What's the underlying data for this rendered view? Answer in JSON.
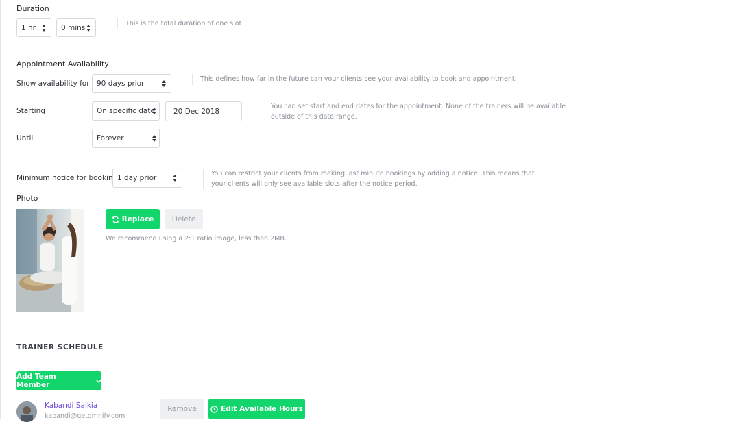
{
  "duration": {
    "title": "Duration",
    "hours": "1 hr",
    "minutes": "0 mins",
    "hint": "This is the total duration of one slot"
  },
  "availability": {
    "title": "Appointment Availability",
    "show_label": "Show availability for",
    "show_value": "90 days prior",
    "show_hint": "This defines how far in the future can your clients see your availability to book and appointment.",
    "starting_label": "Starting",
    "starting_value": "On specific date",
    "start_date": "20 Dec 2018",
    "starting_hint_line1": "You can set start and end dates for the appointment. None of the trainers will be available",
    "starting_hint_line2": "outside of this date range.",
    "until_label": "Until",
    "until_value": "Forever",
    "notice_label": "Minimum notice for booking",
    "notice_value": "1 day prior",
    "notice_hint_line1": "You can restrict your clients from making last minute bookings by adding a notice. This means that",
    "notice_hint_line2": "your clients will only see available slots after the notice period."
  },
  "photo": {
    "title": "Photo",
    "replace_label": "Replace",
    "delete_label": "Delete",
    "recommendation": "We recommend using a 2:1 ratio image, less than 2MB."
  },
  "trainer_schedule": {
    "title": "TRAINER SCHEDULE",
    "add_member_label": "Add Team Member",
    "trainer_name": "Kabandi Saikia",
    "trainer_email": "kabandi@getomnify.com",
    "remove_label": "Remove",
    "edit_hours_label": "Edit Available Hours"
  },
  "colors": {
    "accent_green": "#12d66b",
    "link_purple": "#6a4bd8"
  }
}
